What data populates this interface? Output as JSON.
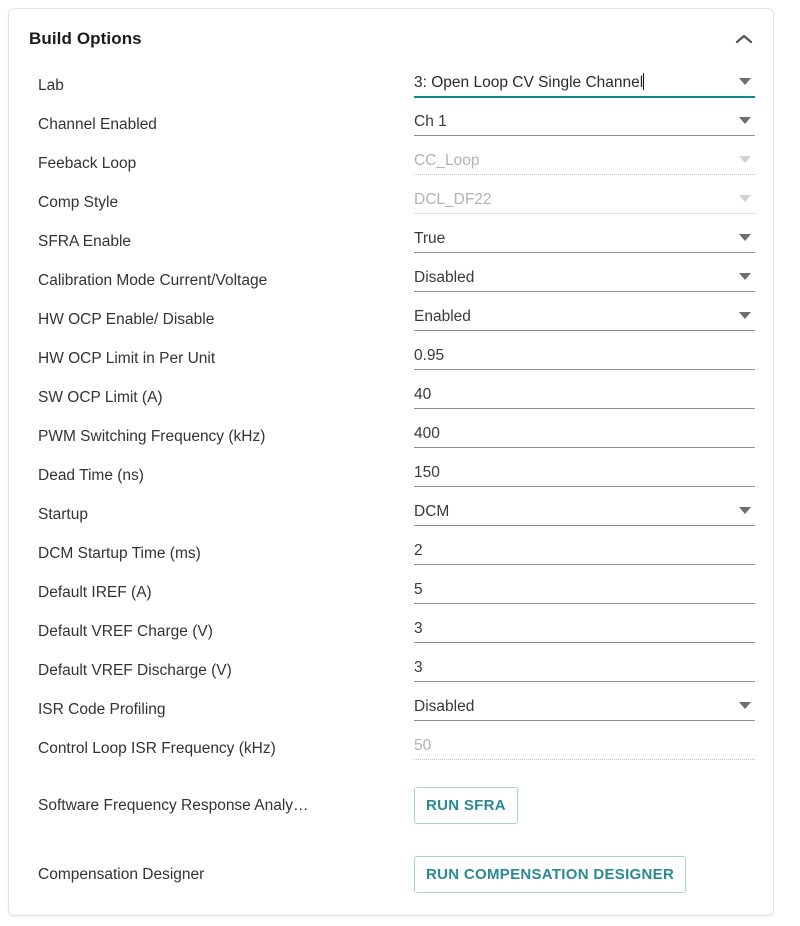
{
  "panel": {
    "title": "Build Options",
    "collapse_icon": "chevron-up-icon"
  },
  "rows": [
    {
      "label": "Lab",
      "value": "3: Open Loop CV Single Channel",
      "control": "select",
      "state": "active"
    },
    {
      "label": "Channel Enabled",
      "value": "Ch 1",
      "control": "select",
      "state": "enabled"
    },
    {
      "label": "Feeback Loop",
      "value": "CC_Loop",
      "control": "select",
      "state": "disabled"
    },
    {
      "label": "Comp Style",
      "value": "DCL_DF22",
      "control": "select",
      "state": "disabled"
    },
    {
      "label": "SFRA Enable",
      "value": "True",
      "control": "select",
      "state": "enabled"
    },
    {
      "label": "Calibration Mode Current/Voltage",
      "value": "Disabled",
      "control": "select",
      "state": "enabled"
    },
    {
      "label": "HW OCP Enable/ Disable",
      "value": "Enabled",
      "control": "select",
      "state": "enabled"
    },
    {
      "label": "HW OCP Limit in Per Unit",
      "value": "0.95",
      "control": "input",
      "state": "enabled"
    },
    {
      "label": "SW OCP Limit (A)",
      "value": "40",
      "control": "input",
      "state": "enabled"
    },
    {
      "label": "PWM Switching Frequency (kHz)",
      "value": "400",
      "control": "input",
      "state": "enabled"
    },
    {
      "label": "Dead Time (ns)",
      "value": "150",
      "control": "input",
      "state": "enabled"
    },
    {
      "label": "Startup",
      "value": "DCM",
      "control": "select",
      "state": "enabled"
    },
    {
      "label": "DCM Startup Time (ms)",
      "value": "2",
      "control": "input",
      "state": "enabled"
    },
    {
      "label": "Default IREF (A)",
      "value": "5",
      "control": "input",
      "state": "enabled"
    },
    {
      "label": "Default VREF Charge (V)",
      "value": "3",
      "control": "input",
      "state": "enabled"
    },
    {
      "label": "Default VREF Discharge (V)",
      "value": "3",
      "control": "input",
      "state": "enabled"
    },
    {
      "label": "ISR Code Profiling",
      "value": "Disabled",
      "control": "select",
      "state": "enabled"
    },
    {
      "label": "Control Loop ISR Frequency (kHz)",
      "value": "50",
      "control": "input",
      "state": "disabled"
    }
  ],
  "action_rows": [
    {
      "label": "Software Frequency Response Analy…",
      "button_label": "RUN SFRA"
    },
    {
      "label": "Compensation Designer",
      "button_label": "RUN COMPENSATION DESIGNER"
    }
  ],
  "colors": {
    "accent_teal": "#0e7c84",
    "button_text": "#2a8a94",
    "button_border": "#a7d3d8",
    "label_text": "#333333",
    "disabled_text": "#b3b3b3",
    "panel_border": "#e3e3e3"
  }
}
